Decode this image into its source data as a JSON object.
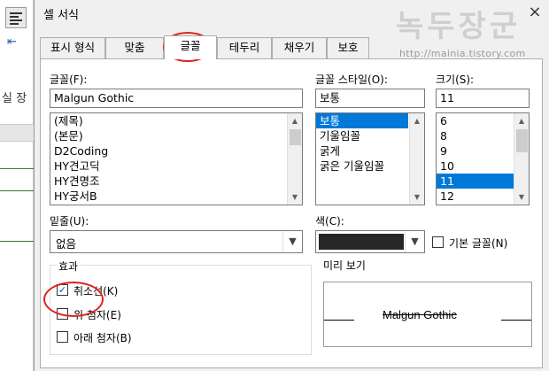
{
  "background": {
    "fragment_text": "실 장"
  },
  "dialog": {
    "title": "셀 서식",
    "close": "×"
  },
  "watermark": {
    "title": "녹두장군",
    "url": "http://mainia.tistory.com"
  },
  "tabs": [
    {
      "label": "표시 형식",
      "active": false
    },
    {
      "label": "맞춤",
      "active": false
    },
    {
      "label": "글꼴",
      "active": true
    },
    {
      "label": "테두리",
      "active": false
    },
    {
      "label": "채우기",
      "active": false
    },
    {
      "label": "보호",
      "active": false
    }
  ],
  "font": {
    "label": "글꼴(F):",
    "value": "Malgun Gothic",
    "items": [
      "(제목)",
      "(본문)",
      "D2Coding",
      "HY견고딕",
      "HY견명조",
      "HY궁서B"
    ]
  },
  "style": {
    "label": "글꼴 스타일(O):",
    "value": "보통",
    "items": [
      "보통",
      "기울임꼴",
      "굵게",
      "굵은 기울임꼴"
    ],
    "selected": "보통"
  },
  "size": {
    "label": "크기(S):",
    "value": "11",
    "items": [
      "6",
      "8",
      "9",
      "10",
      "11",
      "12"
    ],
    "selected": "11"
  },
  "underline": {
    "label": "밑줄(U):",
    "value": "없음"
  },
  "color": {
    "label": "색(C):",
    "swatch": "#262626",
    "default_font_label": "기본 글꼴(N)"
  },
  "effects": {
    "title": "효과",
    "strikethrough": {
      "label": "취소선(K)",
      "checked": true
    },
    "superscript": {
      "label": "위 첨자(E)",
      "checked": false
    },
    "subscript": {
      "label": "아래 첨자(B)",
      "checked": false
    }
  },
  "preview": {
    "title": "미리 보기",
    "text": "Malgun Gothic"
  },
  "colors": {
    "selection": "#0078d7",
    "annotation": "#e02020"
  }
}
